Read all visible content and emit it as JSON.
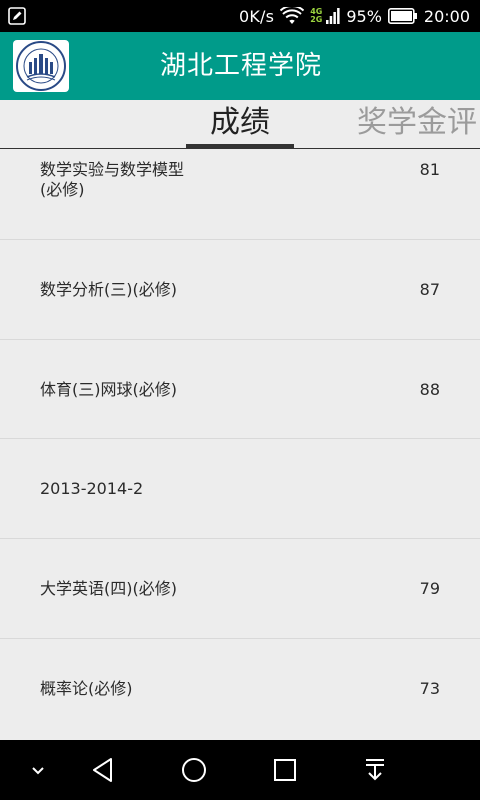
{
  "status_bar": {
    "network_speed": "0K/s",
    "net_4g": "4G",
    "net_2g": "2G",
    "battery": "95%",
    "time": "20:00"
  },
  "header": {
    "title": "湖北工程学院",
    "color": "#009b8a"
  },
  "tabs": [
    {
      "label": "成绩"
    },
    {
      "label": "奖学金评"
    }
  ],
  "grades": [
    {
      "course": "数学实验与数学模型(必修)",
      "score": "81"
    },
    {
      "course": "数学分析(三)(必修)",
      "score": "87"
    },
    {
      "course": "体育(三)网球(必修)",
      "score": "88"
    },
    {
      "course": "2013-2014-2",
      "score": ""
    },
    {
      "course": "大学英语(四)(必修)",
      "score": "79"
    },
    {
      "course": "概率论(必修)",
      "score": "73"
    }
  ],
  "nav_icons": [
    "chevron-down-icon",
    "back-icon",
    "home-icon",
    "recents-icon",
    "notification-pull-icon"
  ]
}
